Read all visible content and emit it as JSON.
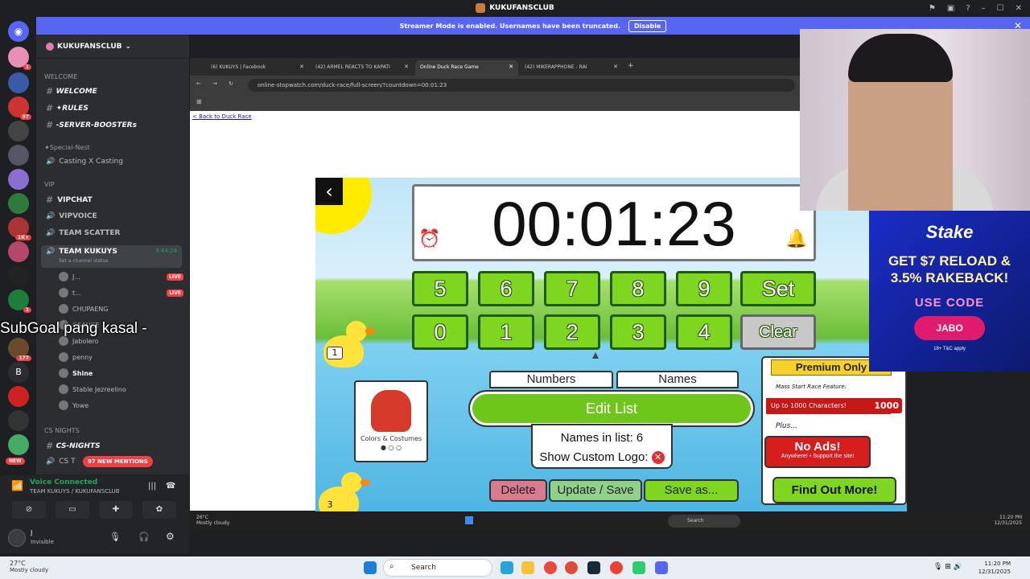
{
  "window": {
    "title": "KUKUFANSCLUB"
  },
  "streamer_bar": {
    "message": "Streamer Mode is enabled. Usernames have been truncated.",
    "button": "Disable"
  },
  "server_list": {
    "new_label": "NEW",
    "letter": "B",
    "badges": [
      "1",
      "97",
      "1K+",
      "1",
      "177"
    ]
  },
  "sidebar": {
    "server_name": "KUKUFANSCLUB",
    "categories": {
      "welcome": "WELCOME",
      "special_nest": "✦Special-Nest",
      "vip": "VIP",
      "cs_nights": "CS NIGHTS"
    },
    "channels": {
      "welcome": "WELCOME",
      "rules": "✦RULES",
      "boosters": "-SERVER-BOOSTERs",
      "casting": "Casting X Casting",
      "vipchat": "VIPCHAT",
      "vipvoice": "VIPVOICE",
      "scatter": "TEAM SCATTER",
      "kukuys": "TEAM KUKUYS",
      "kukuys_time": "3:44:24",
      "kukuys_status": "Set a channel status",
      "cs_nights": "CS-NIGHTS",
      "cs_t": "CS T"
    },
    "voice_users": [
      {
        "name": "J...",
        "live": "LIVE"
      },
      {
        "name": "t...",
        "live": "LIVE"
      },
      {
        "name": "CHUPAENG"
      },
      {
        "name": "GSAUCE"
      },
      {
        "name": "Jabolero"
      },
      {
        "name": "penny"
      },
      {
        "name": "Shine"
      },
      {
        "name": "Stable Jezreelino"
      },
      {
        "name": "Yowe"
      }
    ],
    "mentions": "97 NEW MENTIONS"
  },
  "voice_panel": {
    "status": "Voice Connected",
    "channel": "TEAM KUKUYS / KUKUFANSCLUB"
  },
  "user_panel": {
    "name": "J",
    "status": "Invisible"
  },
  "overlay_text": "SubGoal pang kasal -",
  "browser": {
    "tabs": [
      "(6) KUKUYS | Facebook",
      "(42) ARMEL REACTS TO KAPATI",
      "Online Duck Race Game",
      "(42) MIKERAPPHONE - RAI"
    ],
    "url": "online-stopwatch.com/duck-race/full-screen/?countdown=00:01:23",
    "back_link": "< Back to Duck Race"
  },
  "game": {
    "timer": "00:01:23",
    "keys_row1": [
      "5",
      "6",
      "7",
      "8",
      "9"
    ],
    "set": "Set",
    "keys_row2": [
      "0",
      "1",
      "2",
      "3",
      "4"
    ],
    "clear": "Clear",
    "duck1_number": "1",
    "duck3_number": "3",
    "costume_label": "Colors & Costumes",
    "tab_numbers": "Numbers",
    "tab_names": "Names",
    "edit_list": "Edit List",
    "names_in_list": "Names in list: 6",
    "custom_logo": "Show Custom Logo:",
    "delete": "Delete",
    "update_save": "Update / Save",
    "save_as": "Save as...",
    "premium": {
      "header": "Premium Only",
      "feature": "Mass Start Race Feature:",
      "chars": "Up to 1000 Characters!",
      "chars_num": "1000",
      "plus": "Plus...",
      "noads": "No Ads!",
      "noads_sub": "Anywhere! • Support the site!",
      "find": "Find Out More!"
    }
  },
  "stake_ad": {
    "logo": "Stake",
    "headline1": "GET $7 RELOAD &",
    "headline2": "3.5% RAKEBACK!",
    "use_code": "USE CODE",
    "code": "JABO",
    "tc": "18+ T&C apply"
  },
  "inner_taskbar": {
    "temp": "26°C",
    "weather": "Mostly cloudy",
    "search": "Search",
    "time": "11:20 PM",
    "date": "12/31/2025"
  },
  "taskbar": {
    "temp": "27°C",
    "weather": "Mostly cloudy",
    "search": "Search",
    "time": "11:20 PM",
    "date": "12/31/2025"
  }
}
